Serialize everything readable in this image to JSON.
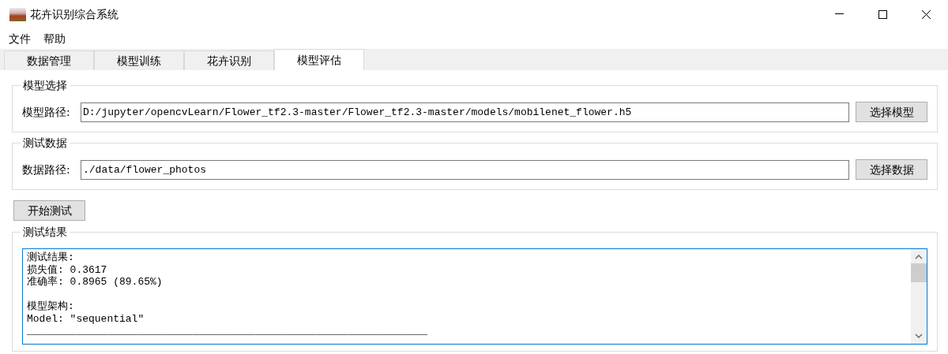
{
  "window": {
    "title": "花卉识别综合系统"
  },
  "menu": [
    "文件",
    "帮助"
  ],
  "tabs": [
    {
      "label": "数据管理",
      "selected": false
    },
    {
      "label": "模型训练",
      "selected": false
    },
    {
      "label": "花卉识别",
      "selected": false
    },
    {
      "label": "模型评估",
      "selected": true
    }
  ],
  "groups": [
    {
      "title": "模型选择",
      "label": "模型路径:",
      "value": "D:/jupyter/opencvLearn/Flower_tf2.3-master/Flower_tf2.3-master/models/mobilenet_flower.h5",
      "button": "选择模型"
    },
    {
      "title": "测试数据",
      "label": "数据路径:",
      "value": "./data/flower_photos",
      "button": "选择数据"
    }
  ],
  "start_button": "开始测试",
  "results": {
    "title": "测试结果",
    "blocks": [
      [
        "测试结果:",
        "损失值: 0.3617",
        "准确率: 0.8965 (89.65%)"
      ],
      [
        "模型架构:",
        "Model: ″sequential″",
        "_________________________________________________________________"
      ]
    ]
  }
}
